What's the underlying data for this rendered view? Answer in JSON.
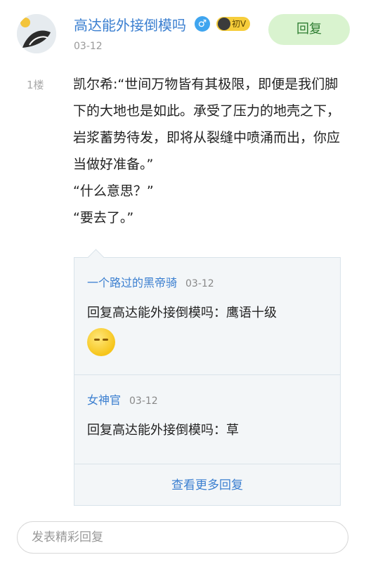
{
  "post": {
    "username": "高达能外接倒模吗",
    "gender_icon": "male-icon",
    "level_badge": "初V",
    "date": "03-12",
    "reply_button": "回复",
    "floor": "1楼",
    "content": [
      "凯尔希:“世间万物皆有其极限，即便是我们脚下的大地也是如此。承受了压力的地壳之下，岩浆蓄势待发，即将从裂缝中喷涌而出，你应当做好准备。”",
      "“什么意思？”",
      "“要去了。”"
    ]
  },
  "subreplies": [
    {
      "name": "一个路过的黑帝骑",
      "date": "03-12",
      "text": "回复高达能外接倒模吗：鹰语十级",
      "emoji": "sly-smile-emoji"
    },
    {
      "name": "女神官",
      "date": "03-12",
      "text": "回复高达能外接倒模吗：草"
    }
  ],
  "more_replies": "查看更多回复",
  "reply_input": {
    "placeholder": "发表精彩回复"
  },
  "colors": {
    "link": "#3b7fd0",
    "reply_button_bg": "#d9f3cf"
  }
}
